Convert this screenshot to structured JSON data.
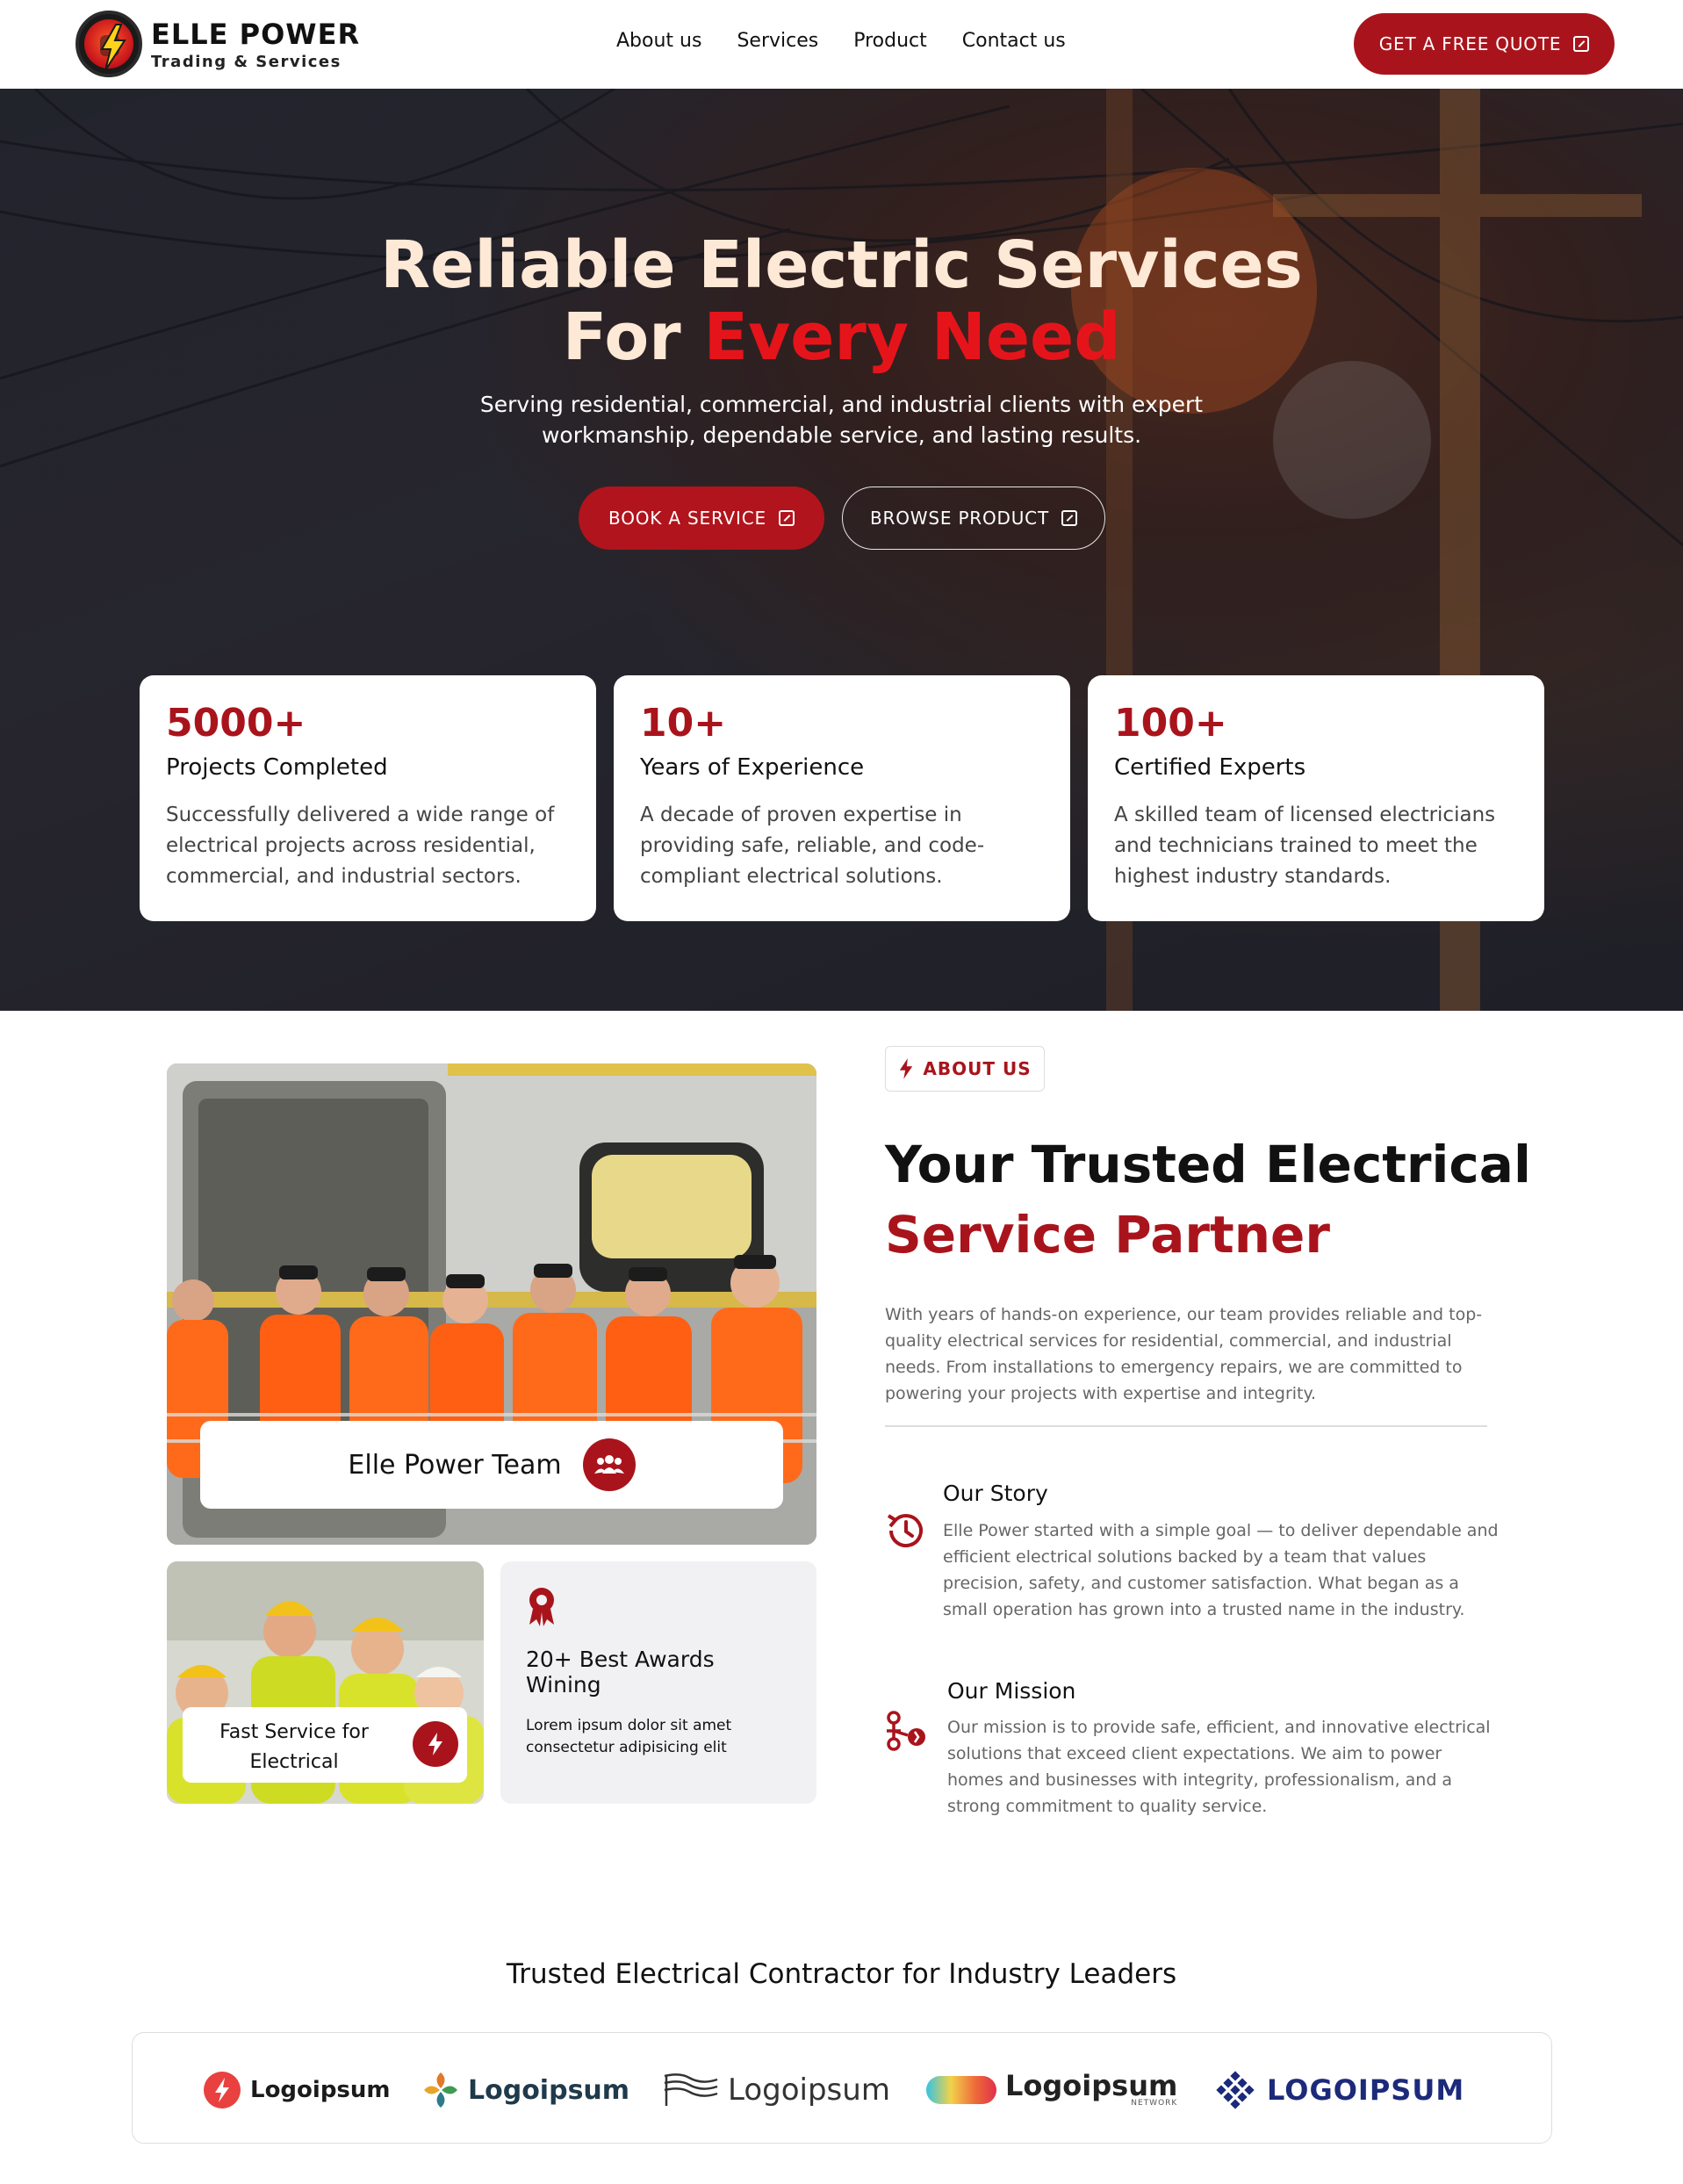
{
  "brand": {
    "name": "ELLE POWER",
    "tagline": "Trading & Services",
    "accent": "#a9141c",
    "hero_accent": "#e5141b"
  },
  "nav": {
    "items": [
      "About us",
      "Services",
      "Product",
      "Contact us"
    ],
    "cta": "GET A FREE QUOTE"
  },
  "hero": {
    "title_line1": "Reliable Electric Services",
    "title_line2_plain": "For ",
    "title_line2_accent": "Every Need",
    "subtitle": "Serving residential, commercial, and industrial clients with expert workmanship, dependable service, and lasting results.",
    "primary_button": "BOOK A SERVICE",
    "secondary_button": "BROWSE PRODUCT"
  },
  "stats": [
    {
      "number": "5000+",
      "title": "Projects Completed",
      "desc": "Successfully delivered a wide range of electrical projects across residential, commercial, and industrial sectors."
    },
    {
      "number": "10+",
      "title": "Years of Experience",
      "desc": "A decade of proven expertise in providing safe, reliable, and code-compliant electrical solutions."
    },
    {
      "number": "100+",
      "title": "Certified Experts",
      "desc": "A skilled team of licensed electricians and technicians trained to meet the highest industry standards."
    }
  ],
  "about": {
    "badge": "ABOUT US",
    "heading_plain": "Your Trusted Electrical",
    "heading_accent": "Service Partner",
    "intro": "With years of hands-on experience, our team provides reliable and top-quality electrical services for residential, commercial, and industrial needs. From installations to emergency repairs, we are committed to powering your projects with expertise and integrity.",
    "team_label": "Elle Power Team",
    "fast_label": "Fast Service for Electrical",
    "award_title": "20+ Best Awards Wining",
    "award_desc": "Lorem ipsum dolor sit amet consectetur adipisicing elit",
    "story_title": "Our Story",
    "story_desc": "Elle Power started with a simple goal — to deliver dependable and efficient electrical solutions backed by a team that values precision, safety, and customer satisfaction. What began as a small operation has grown into a trusted name in the industry.",
    "mission_title": "Our Mission",
    "mission_desc": "Our mission is to provide safe, efficient, and innovative electrical solutions that exceed client expectations. We aim to power homes and businesses with integrity, professionalism, and a strong commitment to quality service."
  },
  "trusted": {
    "heading": "Trusted Electrical Contractor for Industry Leaders",
    "logos": [
      "Logoipsum",
      "Logoipsum",
      "Logoipsum",
      "Logoipsum",
      "LOGOIPSUM"
    ],
    "logo4_sub": "NETWORK"
  }
}
